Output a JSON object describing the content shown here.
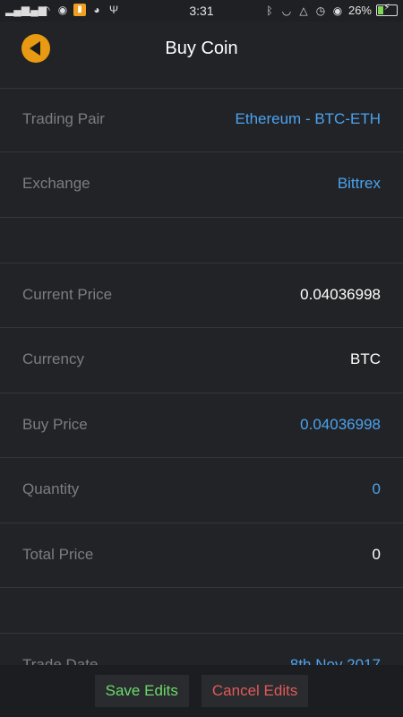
{
  "statusbar": {
    "time": "3:31",
    "battery": "26%",
    "battery_level": 0.26,
    "left_icons": [
      "signal-icon",
      "signal-icon",
      "wifi-icon",
      "messenger-icon",
      "app-icon",
      "cat-icon",
      "usb-icon"
    ],
    "right_icons": [
      "bluetooth-icon",
      "headset-icon",
      "bell-off-icon",
      "alarm-icon",
      "eye-icon"
    ]
  },
  "header": {
    "title": "Buy Coin"
  },
  "rows": {
    "trading_pair": {
      "label": "Trading Pair",
      "value": "Ethereum - BTC-ETH"
    },
    "exchange": {
      "label": "Exchange",
      "value": "Bittrex"
    },
    "current_price": {
      "label": "Current Price",
      "value": "0.04036998"
    },
    "currency": {
      "label": "Currency",
      "value": "BTC"
    },
    "buy_price": {
      "label": "Buy Price",
      "value": "0.04036998"
    },
    "quantity": {
      "label": "Quantity",
      "value": "0"
    },
    "total_price": {
      "label": "Total Price",
      "value": "0"
    },
    "trade_date": {
      "label": "Trade Date",
      "value": "8th Nov 2017"
    }
  },
  "actions": {
    "save": "Save Edits",
    "cancel": "Cancel Edits"
  },
  "colors": {
    "accent": "#e89a12",
    "link": "#4ba3f0",
    "save": "#6bdb6b",
    "cancel": "#e05a5a",
    "background": "#222326"
  }
}
